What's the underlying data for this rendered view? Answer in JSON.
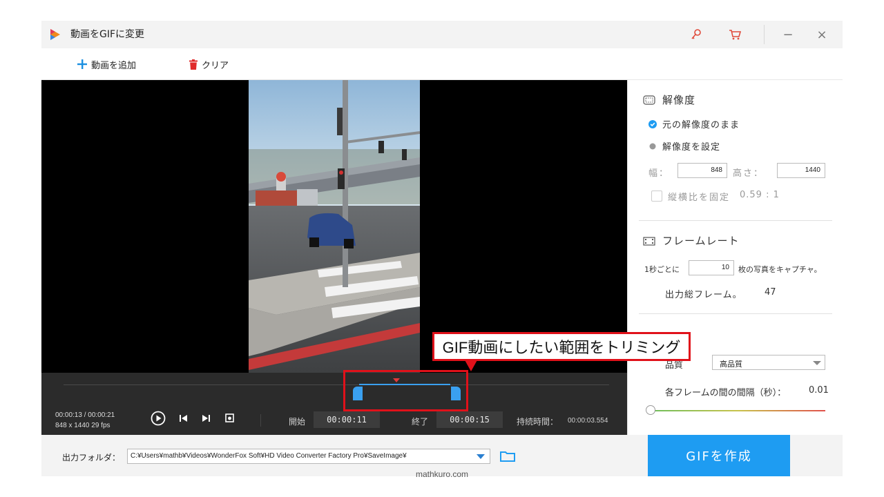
{
  "window": {
    "title": "動画をGIFに変更",
    "key_icon": "key-icon",
    "cart_icon": "cart-icon",
    "minimize": "−",
    "close": "×"
  },
  "toolbar": {
    "add_video": "動画を追加",
    "clear": "クリア"
  },
  "player": {
    "time": "00:00:13 / 00:00:21",
    "info": "848 x 1440   29 fps",
    "start_label": "開始",
    "start_value": "00:00:11",
    "end_label": "終了",
    "end_value": "00:00:15",
    "duration_label": "持続時間：",
    "duration_value": "00:00:03.554"
  },
  "output": {
    "label": "出力フォルダ：",
    "path": "C:¥Users¥mathb¥Videos¥WonderFox Soft¥HD Video Converter Factory Pro¥SaveImage¥",
    "create_button": "GIFを作成"
  },
  "resolution": {
    "title": "解像度",
    "option_original": "元の解像度のまま",
    "option_custom": "解像度を設定",
    "width_label": "幅：",
    "width_value": "848",
    "height_label": "高さ：",
    "height_value": "1440",
    "aspect_label": "縦横比を固定",
    "aspect_value": "0.59 : 1"
  },
  "framerate": {
    "title": "フレームレート",
    "per_second_label": "1秒ごとに",
    "per_second_value": "10",
    "capture_label": "枚の写真をキャプチャ。",
    "total_label": "出力総フレーム。",
    "total_value": "47"
  },
  "quality": {
    "label": "品質",
    "selected": "高品質",
    "interval_label": "各フレームの間の間隔（秒）：",
    "interval_value": "0.01"
  },
  "annotation": {
    "callout": "GIF動画にしたい範囲をトリミング"
  },
  "watermark": "mathkuro.com",
  "colors": {
    "accent": "#1e9cf2",
    "trim": "#3aa0f0",
    "highlight": "#e0111a",
    "playhead": "#e23a3a",
    "clear_icon": "#e02a2a",
    "add_icon": "#1a8fe0"
  }
}
